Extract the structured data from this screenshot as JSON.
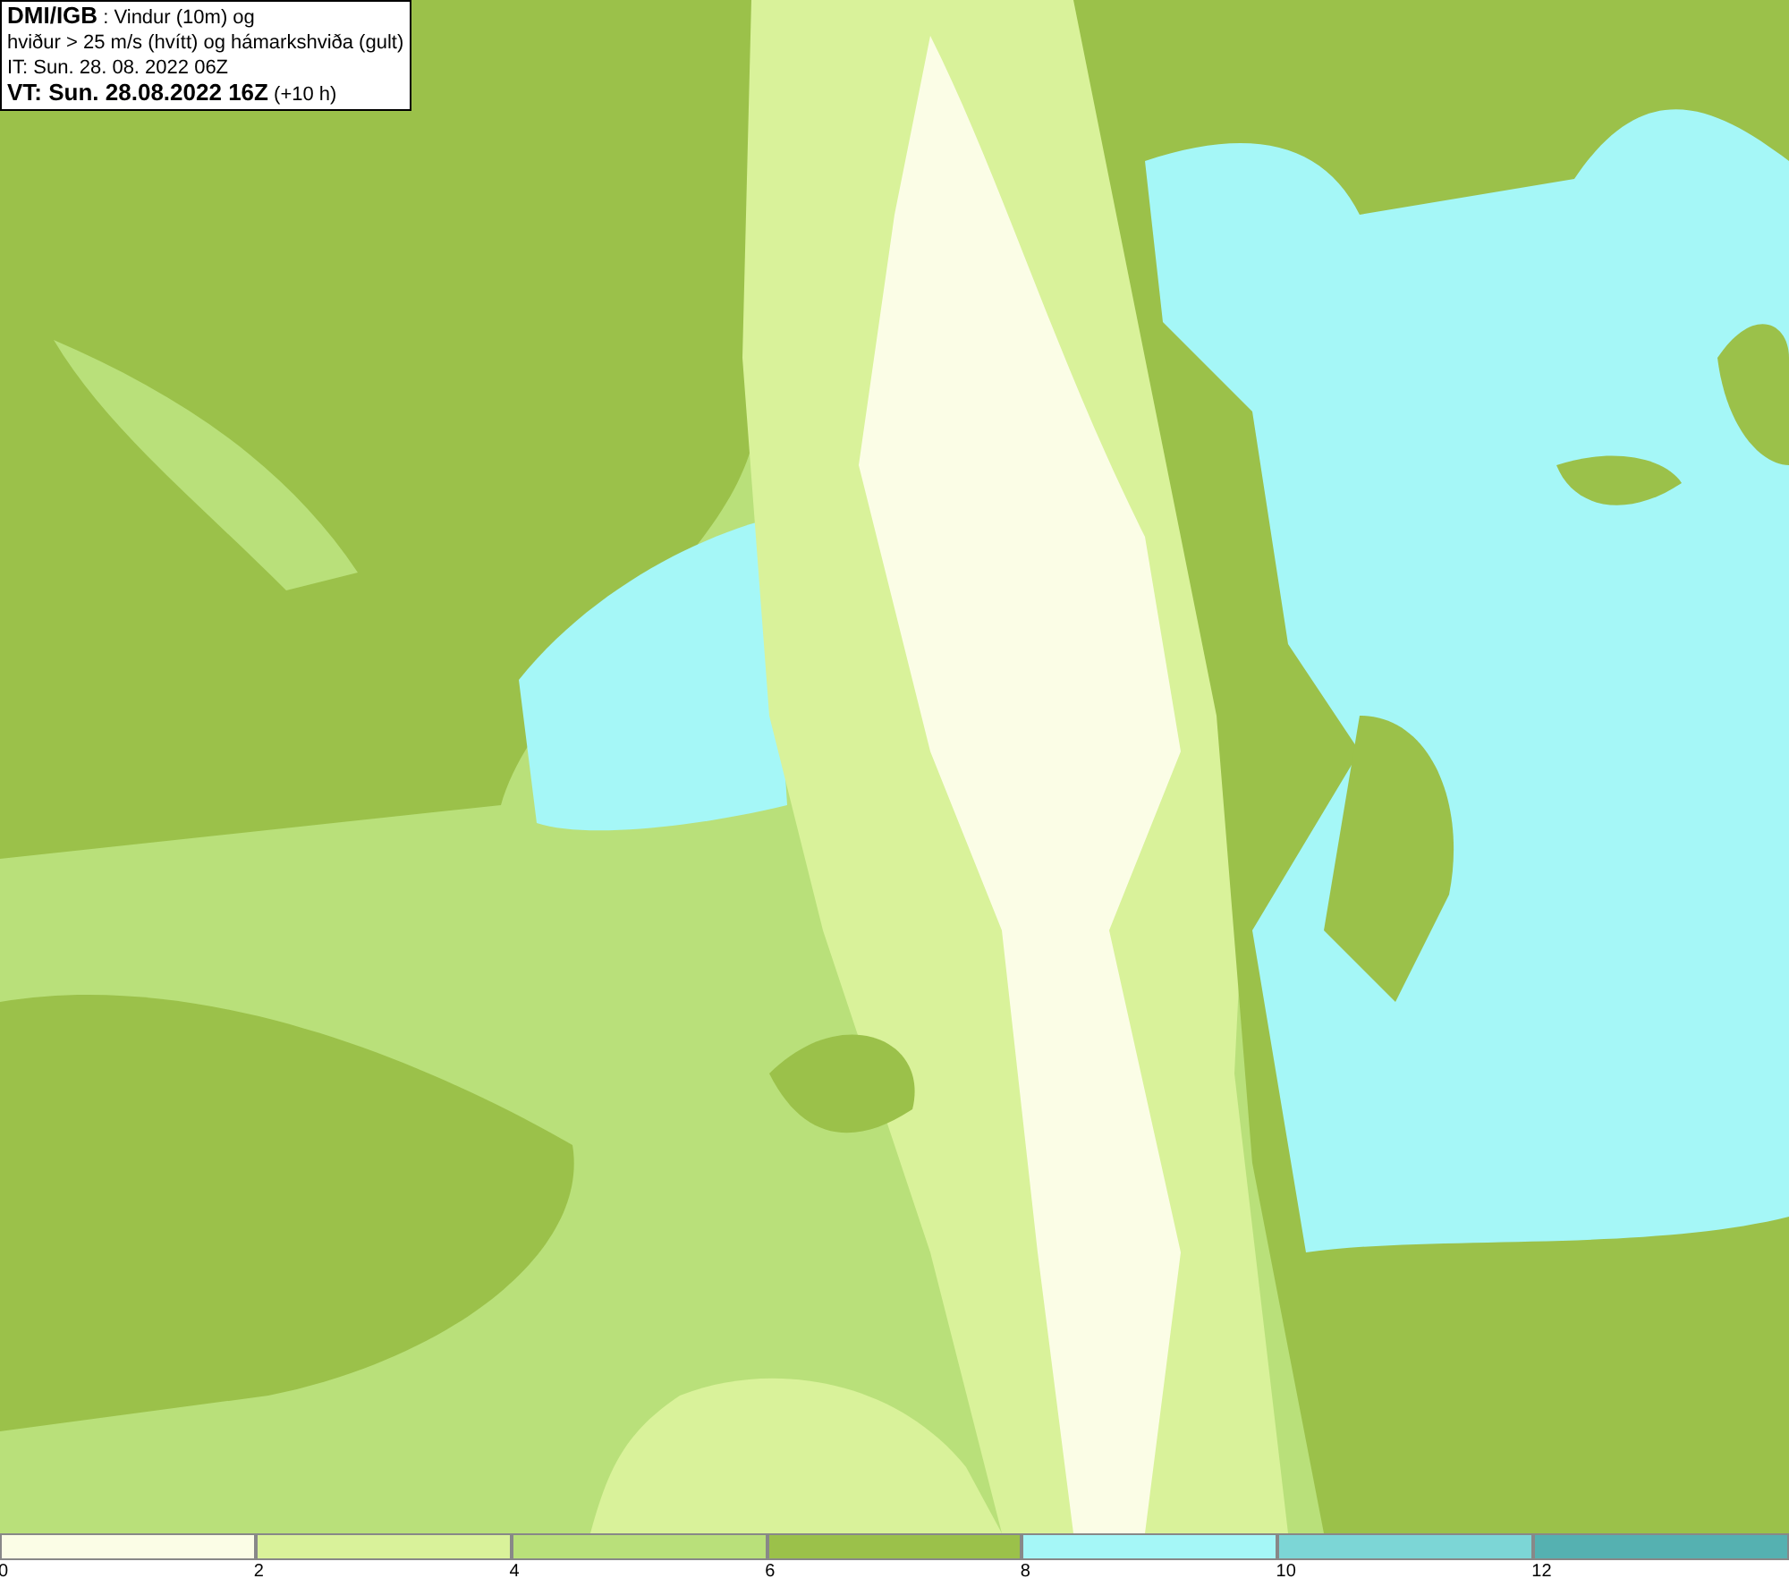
{
  "title_box": {
    "lines": [
      "**DMI/IGB** : Vindur (10m) og",
      "hviður > 25 m/s (hvítt) og hámarkshviða (gult)",
      "IT: Sun. 28. 08. 2022 06Z",
      "**VT: Sun. 28.08.2022 16Z** (+10 h)"
    ]
  },
  "legend": {
    "segments": [
      {
        "label": "0",
        "color": "#fbfde6"
      },
      {
        "label": "2",
        "color": "#d9f29a"
      },
      {
        "label": "4",
        "color": "#b9e07a"
      },
      {
        "label": "6",
        "color": "#9bc14a"
      },
      {
        "label": "8",
        "color": "#a5f7f7"
      },
      {
        "label": "10",
        "color": "#7cd6d6"
      },
      {
        "label": "12",
        "color": "#55b1b1"
      }
    ]
  }
}
